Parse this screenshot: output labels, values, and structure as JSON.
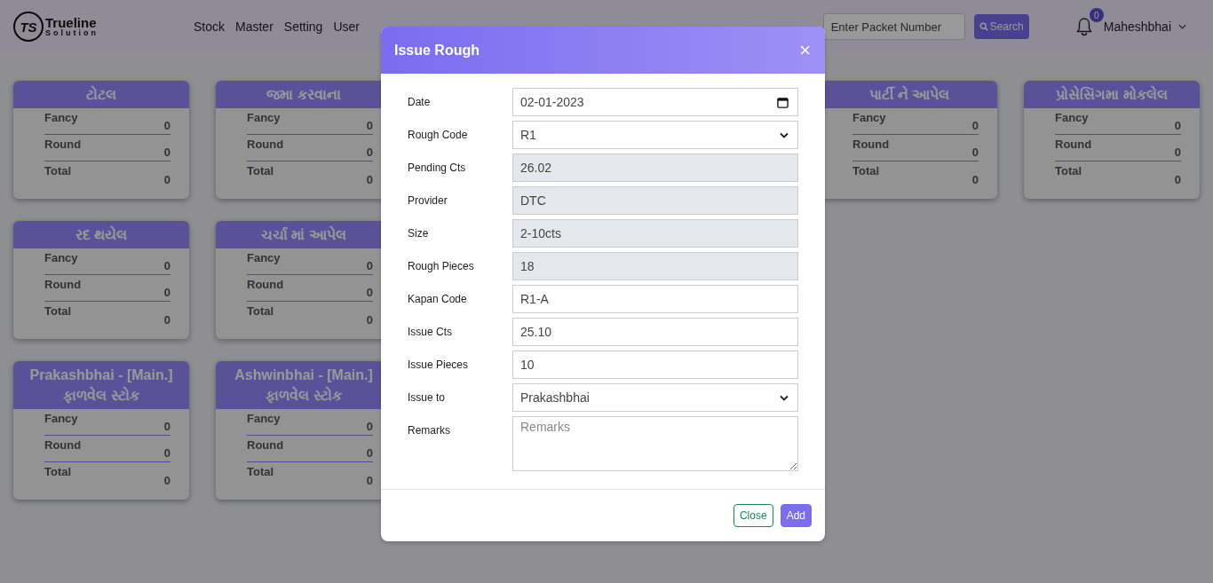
{
  "brand": {
    "name": "Trueline",
    "tagline": "Solution",
    "mark": "TS"
  },
  "nav": [
    {
      "label": "Stock"
    },
    {
      "label": "Master"
    },
    {
      "label": "Setting"
    },
    {
      "label": "User"
    }
  ],
  "search": {
    "placeholder": "Enter Packet Number",
    "button": "Search"
  },
  "notifications": {
    "count": "0"
  },
  "user": {
    "name": "Maheshbhai"
  },
  "card_rows": [
    [
      {
        "title": "ટોટલ",
        "rows": [
          {
            "label": "Fancy",
            "value": "0"
          },
          {
            "label": "Round",
            "value": "0"
          },
          {
            "label": "Total",
            "value": "0"
          }
        ]
      },
      {
        "title": "જમા કરવાના",
        "rows": [
          {
            "label": "Fancy",
            "value": "0"
          },
          {
            "label": "Round",
            "value": "0"
          },
          {
            "label": "Total",
            "value": "0"
          }
        ]
      },
      {
        "title": "પાર્ટી ને આપેલ",
        "rows": [
          {
            "label": "Fancy",
            "value": "0"
          },
          {
            "label": "Round",
            "value": "0"
          },
          {
            "label": "Total",
            "value": "0"
          }
        ]
      },
      {
        "title": "પ્રોસેસિંગમા મોકલેલ",
        "rows": [
          {
            "label": "Fancy",
            "value": "0"
          },
          {
            "label": "Round",
            "value": "0"
          },
          {
            "label": "Total",
            "value": "0"
          }
        ]
      }
    ],
    [
      {
        "title": "રદ થયેલ",
        "rows": [
          {
            "label": "Fancy",
            "value": "0"
          },
          {
            "label": "Round",
            "value": "0"
          },
          {
            "label": "Total",
            "value": "0"
          }
        ]
      },
      {
        "title": "ચર્ચા માં આપેલ",
        "rows": [
          {
            "label": "Fancy",
            "value": "0"
          },
          {
            "label": "Round",
            "value": "0"
          },
          {
            "label": "Total",
            "value": "0"
          }
        ]
      }
    ],
    [
      {
        "title": "Prakashbhai - [Main.]",
        "subtitle": "ફાળવેલ સ્ટોક",
        "rows": [
          {
            "label": "Fancy",
            "value": "0"
          },
          {
            "label": "Round",
            "value": "0"
          },
          {
            "label": "Total",
            "value": "0"
          }
        ]
      },
      {
        "title": "Ashwinbhai - [Main.]",
        "subtitle": "ફાળવેલ સ્ટોક",
        "rows": [
          {
            "label": "Fancy",
            "value": "0"
          },
          {
            "label": "Round",
            "value": "0"
          },
          {
            "label": "Total",
            "value": "0"
          }
        ]
      }
    ]
  ],
  "modal": {
    "title": "Issue Rough",
    "close_icon": "×",
    "fields": [
      {
        "label": "Date",
        "kind": "date",
        "value": "02-01-2023",
        "disabled": false
      },
      {
        "label": "Rough Code",
        "kind": "select",
        "value": "R1",
        "disabled": false
      },
      {
        "label": "Pending Cts",
        "kind": "input",
        "value": "26.02",
        "disabled": true
      },
      {
        "label": "Provider",
        "kind": "input",
        "value": "DTC",
        "disabled": true
      },
      {
        "label": "Size",
        "kind": "input",
        "value": "2-10cts",
        "disabled": true
      },
      {
        "label": "Rough Pieces",
        "kind": "input",
        "value": "18",
        "disabled": true
      },
      {
        "label": "Kapan Code",
        "kind": "input",
        "value": "R1-A",
        "disabled": false
      },
      {
        "label": "Issue Cts",
        "kind": "input",
        "value": "25.10",
        "disabled": false
      },
      {
        "label": "Issue Pieces",
        "kind": "input",
        "value": "10",
        "disabled": false
      },
      {
        "label": "Issue to",
        "kind": "select",
        "value": "Prakashbhai",
        "disabled": false
      },
      {
        "label": "Remarks",
        "kind": "textarea",
        "placeholder": "Remarks",
        "disabled": false
      }
    ],
    "buttons": [
      {
        "label": "Close",
        "kind": "secondary"
      },
      {
        "label": "Add",
        "kind": "primary"
      }
    ]
  }
}
